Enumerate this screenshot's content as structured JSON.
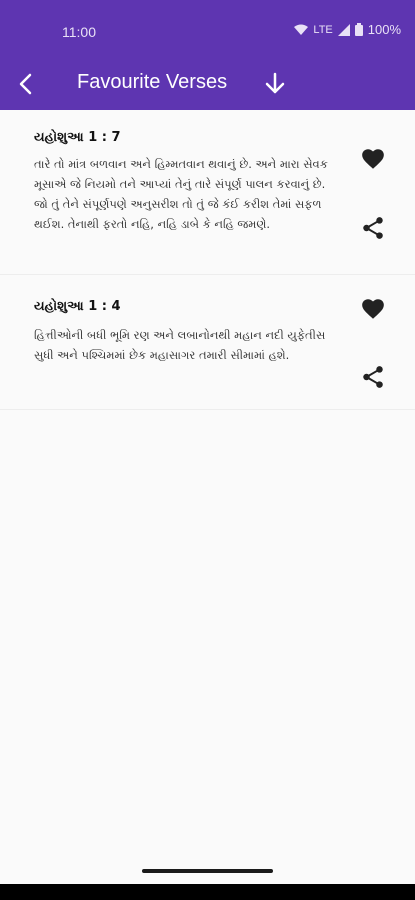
{
  "status": {
    "time": "11:00",
    "network": "LTE",
    "battery": "100%"
  },
  "toolbar": {
    "title": "Favourite Verses",
    "back_icon": "arrow-back-icon",
    "download_icon": "arrow-down-icon"
  },
  "verses": [
    {
      "reference": "યહોશુઆ 1 : 7",
      "text": "તારે તો માંત્ર બળવાન અને હિમ્મતવાન થવાનું છે. અને મારા સેવક મૂસાએ જે નિયમો તને આપ્યાં તેનું તારે સંપૂર્ણ પાલન કરવાનું છે. જો તું તેને સંપૂર્ણપણે અનુસરીશ તો તું જે કંઈ કરીશ તેમાં સફળ થઈશ. તેનાથી ફરતો નહિ, નહિ ડાબે કે નહિ જમણે."
    },
    {
      "reference": "યહોશુઆ 1 : 4",
      "text": "હિત્તીઓની બધી ભૂમિ રણ અને લબાનોનથી મહાન નદી યુફેતીસ સુધી અને પશ્ચિમમાં છેક મહાસાગર તમારી સીમામાં હશે."
    }
  ],
  "colors": {
    "primary": "#5e35b1",
    "background": "#fafafa"
  }
}
